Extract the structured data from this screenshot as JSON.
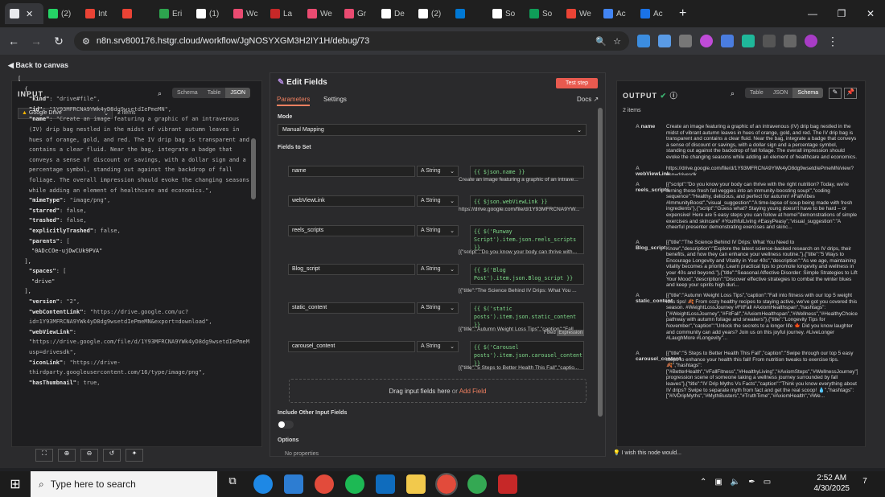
{
  "tabs": [
    {
      "label": "",
      "color": "#e8eaed",
      "active": true
    },
    {
      "label": "(2)",
      "color": "#25d366"
    },
    {
      "label": "Int",
      "color": "#ea4335"
    },
    {
      "label": "",
      "color": "#ea4335"
    },
    {
      "label": "Eri",
      "color": "#2da44e"
    },
    {
      "label": "(1)",
      "color": "#ffffff"
    },
    {
      "label": "Wc",
      "color": "#ea4b71"
    },
    {
      "label": "La",
      "color": "#c62828"
    },
    {
      "label": "We",
      "color": "#ea4b71"
    },
    {
      "label": "Gr",
      "color": "#ea4b71"
    },
    {
      "label": "De",
      "color": "#ffffff"
    },
    {
      "label": "(2)",
      "color": "#ffffff"
    },
    {
      "label": "",
      "color": "#0078d4"
    },
    {
      "label": "So",
      "color": "#ffffff"
    },
    {
      "label": "So",
      "color": "#0f9d58"
    },
    {
      "label": "We",
      "color": "#ea4335"
    },
    {
      "label": "Ac",
      "color": "#4285f4"
    },
    {
      "label": "Ac",
      "color": "#1a73e8"
    }
  ],
  "url": "n8n.srv800176.hstgr.cloud/workflow/JgNOSYXGM3H2IY1H/debug/73",
  "back_label": "Back to canvas",
  "input": {
    "title": "INPUT",
    "tabs": [
      "Schema",
      "Table",
      "JSON"
    ],
    "source": "Google Drive",
    "count": "2 items"
  },
  "json_lines": [
    {
      "t": "["
    },
    {
      "t": "  {"
    },
    {
      "k": "\"kind\"",
      "v": "\"drive#file\","
    },
    {
      "k": "\"id\"",
      "v": "\"1Y93MFRCNA9YWk4yD8dg9wsetdIePmeMN\","
    },
    {
      "k": "\"name\"",
      "v": "\"Create an image featuring a graphic of an intravenous (IV) drip bag nestled in the midst of vibrant autumn leaves in hues of orange, gold, and red. The IV drip bag is transparent and contains a clear fluid. Near the bag, integrate a badge that conveys a sense of discount or savings, with a dollar sign and a percentage symbol, standing out against the backdrop of fall foliage. The overall impression should evoke the changing seasons while adding an element of healthcare and economics.\","
    },
    {
      "k": "\"mimeType\"",
      "v": "\"image/png\","
    },
    {
      "k": "\"starred\"",
      "v": "false,"
    },
    {
      "k": "\"trashed\"",
      "v": "false,"
    },
    {
      "k": "\"explicitlyTrashed\"",
      "v": "false,"
    },
    {
      "k": "\"parents\"",
      "v": "["
    },
    {
      "t": "    \"0ADcCOe-ujDwCUk9PVA\""
    },
    {
      "t": "  ],"
    },
    {
      "k": "\"spaces\"",
      "v": "["
    },
    {
      "t": "    \"drive\""
    },
    {
      "t": "  ],"
    },
    {
      "k": "\"version\"",
      "v": "\"2\","
    },
    {
      "k": "\"webContentLink\"",
      "v": "\"https://drive.google.com/uc?id=1Y93MFRCNA9YWk4yD8dg9wsetdIePmeMN&export=download\","
    },
    {
      "k": "\"webViewLink\"",
      "v": "\"https://drive.google.com/file/d/1Y93MFRCNA9YWk4yD8dg9wsetdIePmeMN/view?usp=drivesdk\","
    },
    {
      "k": "\"iconLink\"",
      "v": "\"https://drive-thirdparty.googleusercontent.com/16/type/image/png\","
    },
    {
      "k": "\"hasThumbnail\"",
      "v": "true,"
    }
  ],
  "edit": {
    "title": "Edit Fields",
    "test_step": "Test step",
    "tab_params": "Parameters",
    "tab_settings": "Settings",
    "docs": "Docs",
    "mode_label": "Mode",
    "mode_value": "Manual Mapping",
    "fields_label": "Fields to Set",
    "type_label": "String",
    "drag_text": "Drag input fields here",
    "or_text": "or",
    "add_field": "Add Field",
    "include_label": "Include Other Input Fields",
    "options_label": "Options",
    "no_props": "No properties",
    "fixed": "Fixed",
    "expression": "Expression"
  },
  "fields": [
    {
      "name": "name",
      "value": "{{ $json.name }}",
      "preview": "Create an image featuring a graphic of an intrave..."
    },
    {
      "name": "webViewLink",
      "value": "{{ $json.webViewLink }}",
      "preview": "https://drive.google.com/file/d/1Y93MFRCNA9YW..."
    },
    {
      "name": "reels_scripts",
      "value": "{{ $('Runway Script').item.json.reels_scripts }}",
      "preview": "[{\"script\":\"Do you know your body can thrive with..."
    },
    {
      "name": "Blog_script",
      "value": "{{ $('Blog Post').item.json.Blog_script }}",
      "preview": "[{\"title\":\"The Science Behind IV Drips: What You ..."
    },
    {
      "name": "static_content",
      "value": "{{ $('static posts').item.json.static_content }}",
      "preview": "[{\"title\":\"Autumn Weight Loss Tips\",\"caption\":\"Fall..."
    },
    {
      "name": "carousel_content",
      "value": "{{ $('Carousel posts').item.json.carousel_content }}",
      "preview": "[{\"title\":\"5 Steps to Better Health This Fall\",\"captio..."
    }
  ],
  "output": {
    "title": "OUTPUT",
    "tabs": [
      "Table",
      "JSON",
      "Schema"
    ],
    "count": "2 items",
    "wish": "I wish this node would..."
  },
  "out_rows": [
    {
      "k": "name",
      "v": "Create an image featuring a graphic of an intravenous (IV) drip bag nestled in the midst of vibrant autumn leaves in hues of orange, gold, and red. The IV drip bag is transparent and contains a clear fluid. Near the bag, integrate a badge that conveys a sense of discount or savings, with a dollar sign and a percentage symbol, standing out against the backdrop of fall foliage. The overall impression should evoke the changing seasons while adding an element of healthcare and economics."
    },
    {
      "k": "webViewLink",
      "v": "https://drive.google.com/file/d/1Y93MFRCNA9YWk4yD8dg9wsetdIePmeMN/view?usp=drivesdk"
    },
    {
      "k": "reels_scripts",
      "v": "[{\"script\":\"Do you know your body can thrive with the right nutrition? Today, we're turning those fresh fall veggies into an immunity-boosting soup!\",\"coding sequence\":\"Healthy, delicious, and perfect for autumn! #FallVibes #ImmunityBoost\",\"visual_suggestion\":\"A time-lapse of soup being made with fresh ingredients\"},{\"script\":\"Guess what? Staying young doesn't have to be hard – or expensive! Here are 5 easy steps you can follow at home!\"demonstrations of simple exercises and skincare\" #YouthfulLiving #EasyPeasy\",\"visual_suggestion\":\"A cheerful presenter demonstrating exercises and skinc..."
    },
    {
      "k": "Blog_script",
      "v": "[{\"title\":\"The Science Behind IV Drips: What You Need to Know\",\"description\":\"Explore the latest science-backed research on IV drips, their benefits, and how they can enhance your wellness routine.\"},{\"title\":\"5 Ways to Encourage Longevity and Vitality in Your 40s\",\"description\":\"As we age, maintaining vitality becomes a priority. Learn practical tips to promote longevity and wellness in your 40s and beyond.\"},{\"title\":\"Seasonal Affective Disorder: Simple Strategies to Lift Your Mood\",\"description\":\"Discover effective strategies to combat the winter blues and keep your spirits high duri..."
    },
    {
      "k": "static_content",
      "v": "[{\"title\":\"Autumn Weight Loss Tips\",\"caption\":\"Fall into fitness with our top 5 weight loss tips! 🍂 From cozy healthy recipes to staying active, we've got you covered this season. #WeightLossJourney #FitFall #AxiomHealthspan\",\"hashtags\":[\"#WeightLossJourney\",\"#FitFall\",\"#AxiomHealthspan\",\"#Wellness\",\"#HealthyChoices\"],\"visual_suggestion\":\"Leafy pathway with autumn foliage and sneakers\"},{\"title\":\"Longevity Tips for November\",\"caption\":\"Unlock the secrets to a longer life 🍁 Did you know laughter and community can add years? Join us on this joyful journey. #LiveLonger #LaughMore #Longevity\"..."
    },
    {
      "k": "carousel_content",
      "v": "[{\"title\":\"5 Steps to Better Health This Fall\",\"caption\":\"Swipe through our top 5 easy steps to enhance your health this fall! From nutrition tweaks to exercise tips. 🍂\",\"hashtags\":[\"#BetterHealth\",\"#FallFitness\",\"#HealthyLiving\",\"#AxiomSteps\",\"#WellnessJourney\"],\"visual_suggestion\":\"A progression scene of someone taking a wellness journey surrounded by fall leaves\"},{\"title\":\"IV Drip Myths Vs Facts\",\"caption\":\"Think you know everything about IV drips? Swipe to separate myth from fact and get the real scoop! 💧\",\"hashtags\":[\"#IVDripMyths\",\"#MythBusters\",\"#TruthTime\",\"#AxiomHealth\",\"#We..."
    }
  ],
  "taskbar": {
    "search": "Type here to search",
    "time": "2:52 AM",
    "date": "4/30/2025",
    "notif": "7"
  }
}
